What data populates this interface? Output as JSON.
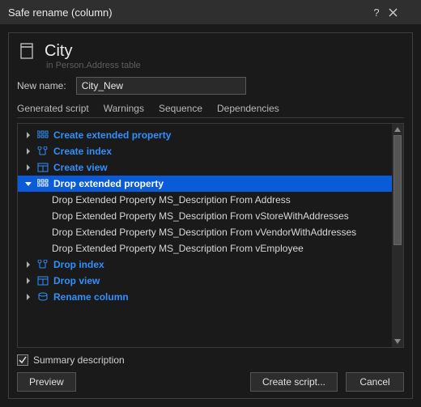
{
  "window": {
    "title": "Safe rename (column)"
  },
  "header": {
    "object_name": "City",
    "context": "in Person.Address table"
  },
  "new_name": {
    "label": "New name:",
    "value": "City_New"
  },
  "tabs": {
    "items": [
      {
        "label": "Generated script"
      },
      {
        "label": "Warnings"
      },
      {
        "label": "Sequence"
      },
      {
        "label": "Dependencies"
      }
    ],
    "active_index": 2
  },
  "tree": {
    "nodes": [
      {
        "label": "Create extended property",
        "expanded": false
      },
      {
        "label": "Create index",
        "expanded": false
      },
      {
        "label": "Create view",
        "expanded": false
      },
      {
        "label": "Drop extended property",
        "expanded": true,
        "selected": true,
        "children": [
          "Drop Extended Property MS_Description From Address",
          "Drop Extended Property MS_Description From vStoreWithAddresses",
          "Drop Extended Property MS_Description From vVendorWithAddresses",
          "Drop Extended Property MS_Description From vEmployee"
        ]
      },
      {
        "label": "Drop index",
        "expanded": false
      },
      {
        "label": "Drop view",
        "expanded": false
      },
      {
        "label": "Rename column",
        "expanded": false
      }
    ]
  },
  "summary": {
    "label": "Summary description",
    "checked": true
  },
  "buttons": {
    "preview": "Preview",
    "create_script": "Create script...",
    "cancel": "Cancel"
  }
}
